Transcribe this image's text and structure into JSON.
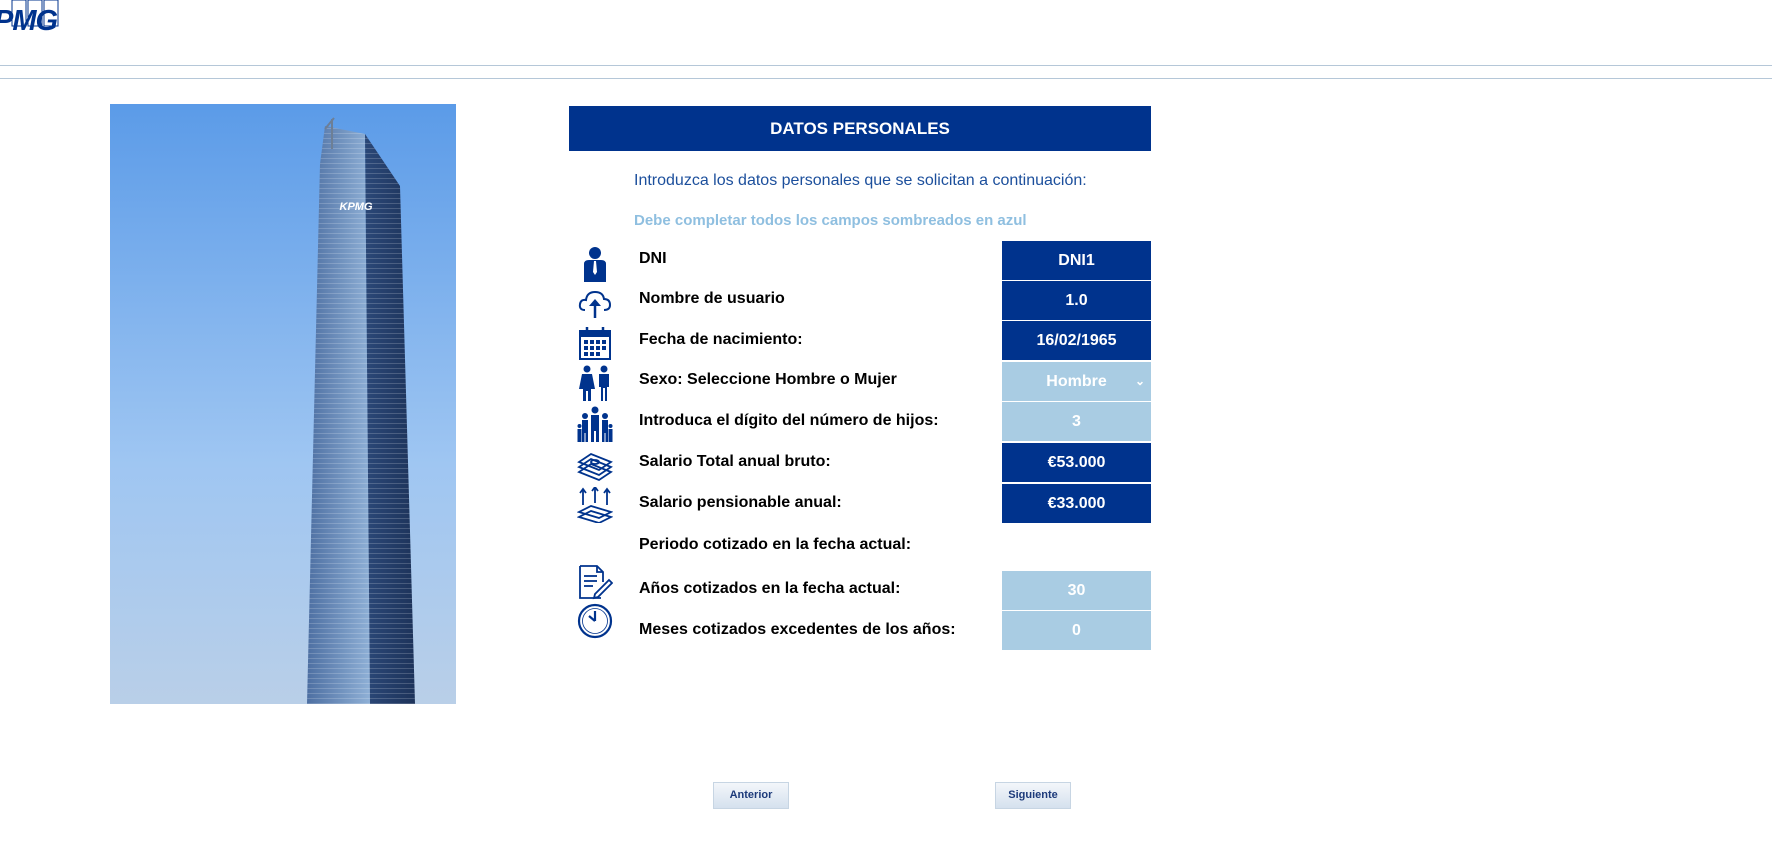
{
  "brand": {
    "logo_text": "PMG",
    "color": "#00338d"
  },
  "photo": {
    "building_sign": "KPMG"
  },
  "panel": {
    "title": "DATOS PERSONALES",
    "intro": "Introduzca los datos personales que se solicitan a continuación:",
    "note": "Debe completar todos los campos sombreados en azul"
  },
  "fields": {
    "dni": {
      "label": "DNI",
      "value": "DNI1",
      "icon": "person-icon"
    },
    "username": {
      "label": "Nombre de usuario",
      "value": "1.0",
      "icon": "cloud-upload-icon"
    },
    "birthdate": {
      "label": "Fecha de nacimiento:",
      "value": "16/02/1965",
      "icon": "calendar-icon"
    },
    "sex": {
      "label": "Sexo: Seleccione Hombre o Mujer",
      "value": "Hombre",
      "icon": "man-woman-icon"
    },
    "children": {
      "label": "Introduca el dígito del número de hijos:",
      "value": "3",
      "icon": "family-icon"
    },
    "gross_salary": {
      "label": "Salario Total anual bruto:",
      "value": "€53.000",
      "icon": "money-stack-icon"
    },
    "pension_salary": {
      "label": "Salario pensionable anual:",
      "value": "€33.000",
      "icon": "money-growth-icon"
    },
    "period_heading": {
      "label": "Periodo cotizado en la fecha actual:"
    },
    "years": {
      "label": "Años cotizados en la fecha actual:",
      "value": "30",
      "icon": "document-edit-icon"
    },
    "months": {
      "label": "Meses cotizados excedentes de los años:",
      "value": "0",
      "icon": "clock-icon"
    }
  },
  "buttons": {
    "prev": "Anterior",
    "next": "Siguiente"
  },
  "colors": {
    "dark_field": "#00338d",
    "light_field": "#a9cce3",
    "header": "#00338d"
  }
}
